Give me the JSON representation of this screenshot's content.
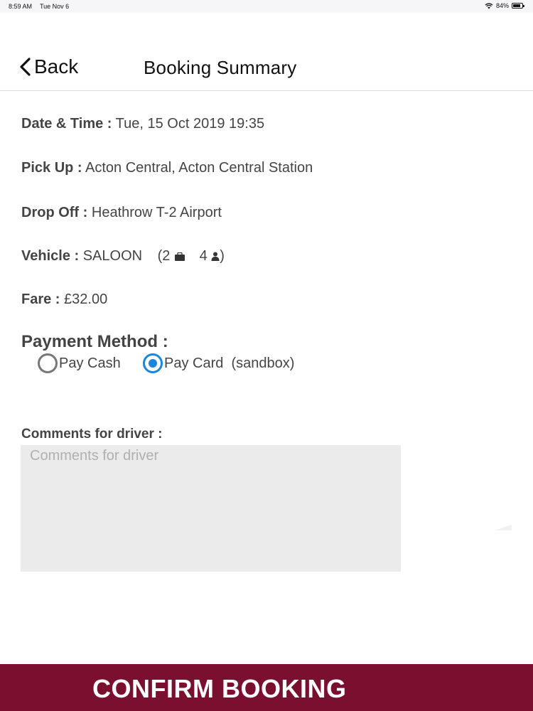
{
  "status_bar": {
    "time": "8:59 AM",
    "date": "Tue Nov 6",
    "battery": "84%",
    "battery_level": 0.84
  },
  "nav": {
    "back_label": "Back",
    "title": "Booking Summary"
  },
  "booking": {
    "date_time": {
      "label": "Date & Time :",
      "value": "Tue, 15 Oct 2019 19:35"
    },
    "pick_up": {
      "label": "Pick Up :",
      "value": "Acton Central, Acton Central Station"
    },
    "drop_off": {
      "label": "Drop Off :",
      "value": "Heathrow T-2 Airport"
    },
    "vehicle": {
      "label": "Vehicle :",
      "value": "SALOON",
      "open": "(2",
      "passengers": "4",
      "close": ")"
    },
    "fare": {
      "label": "Fare :",
      "value": "£32.00"
    }
  },
  "payment": {
    "heading": "Payment Method :",
    "options": [
      {
        "label": "Pay Cash",
        "selected": false
      },
      {
        "label": "Pay Card  (sandbox)",
        "selected": true
      }
    ]
  },
  "comments": {
    "label": "Comments for driver :",
    "placeholder": "Comments for driver"
  },
  "confirm": {
    "label": "CONFIRM BOOKING",
    "color": "#7b0f2f"
  },
  "colors": {
    "accent": "#1a86e0",
    "text": "#444444"
  }
}
